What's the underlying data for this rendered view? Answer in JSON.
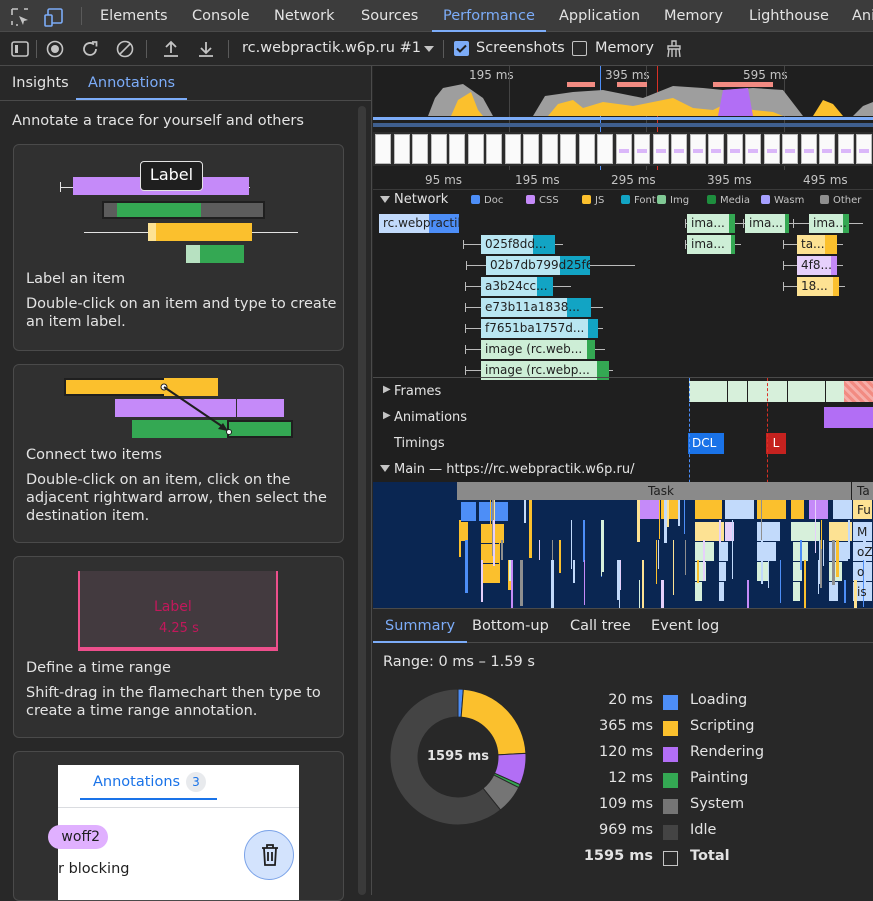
{
  "devtools_tabs": [
    "Elements",
    "Console",
    "Network",
    "Sources",
    "Performance",
    "Application",
    "Memory",
    "Lighthouse",
    "Ani"
  ],
  "active_tab": "Performance",
  "toolbar": {
    "recording_target": "rc.webpractik.w6p.ru #1",
    "screenshots_label": "Screenshots",
    "screenshots_checked": true,
    "memory_label": "Memory",
    "memory_checked": false
  },
  "sidebar": {
    "tabs": [
      "Insights",
      "Annotations"
    ],
    "active": "Annotations",
    "intro": "Annotate a trace for yourself and others",
    "cards": [
      {
        "title": "Label an item",
        "desc": "Double-click on an item and type to create an item label.",
        "demo_label": "Label"
      },
      {
        "title": "Connect two items",
        "desc": "Double-click on an item, click on the adjacent rightward arrow, then select the destination item."
      },
      {
        "title": "Define a time range",
        "desc": "Shift-drag in the flamechart then type to create a time range annotation.",
        "demo_label": "Label",
        "demo_value": "4.25 s"
      },
      {
        "title": "",
        "preview_tab": "Annotations",
        "preview_count": "3",
        "preview_chip": "woff2",
        "preview_text": "r blocking"
      }
    ]
  },
  "overview": {
    "ticks_top": [
      "195 ms",
      "395 ms",
      "595 ms"
    ],
    "ticks_main": [
      "95 ms",
      "195 ms",
      "295 ms",
      "395 ms",
      "495 ms"
    ]
  },
  "network": {
    "title": "Network",
    "legend": [
      {
        "label": "Doc",
        "color": "#4d8ef7"
      },
      {
        "label": "CSS",
        "color": "#c58af9"
      },
      {
        "label": "JS",
        "color": "#fbc02d"
      },
      {
        "label": "Font",
        "color": "#12a4c4"
      },
      {
        "label": "Img",
        "color": "#81c995"
      },
      {
        "label": "Media",
        "color": "#1e8e3e"
      },
      {
        "label": "Wasm",
        "color": "#a6a0ff"
      },
      {
        "label": "Other",
        "color": "#8f8f8f"
      }
    ],
    "requests": [
      "rc.webpractik...",
      "025f8dd...",
      "02b7db799d25f6...",
      "a3b24cc...",
      "e73b11a1838...",
      "f7651ba1757d...",
      "image (rc.web...",
      "image (rc.webp...",
      "ima...",
      "ima...",
      "ima...",
      "ima...",
      "ima...",
      "ta...",
      "4f8...",
      "18..."
    ]
  },
  "tracks": {
    "frames": "Frames",
    "animations": "Animations",
    "timings": "Timings",
    "dcl": "DCL",
    "l": "L",
    "main": "Main — https://rc.webpractik.w6p.ru/",
    "task": "Task",
    "task2": "Ta",
    "flame_labels": [
      "Fu",
      "M",
      "oZ",
      "o",
      "is"
    ]
  },
  "bottom": {
    "tabs": [
      "Summary",
      "Bottom-up",
      "Call tree",
      "Event log"
    ],
    "active": "Summary",
    "range": "Range: 0 ms – 1.59 s",
    "total_center": "1595 ms",
    "rows": [
      {
        "value": "20 ms",
        "name": "Loading",
        "color": "#4d8ef7",
        "ms": 20
      },
      {
        "value": "365 ms",
        "name": "Scripting",
        "color": "#fbc02d",
        "ms": 365
      },
      {
        "value": "120 ms",
        "name": "Rendering",
        "color": "#b26ef5",
        "ms": 120
      },
      {
        "value": "12 ms",
        "name": "Painting",
        "color": "#34a853",
        "ms": 12
      },
      {
        "value": "109 ms",
        "name": "System",
        "color": "#757575",
        "ms": 109
      },
      {
        "value": "969 ms",
        "name": "Idle",
        "color": "#444444",
        "ms": 969
      }
    ],
    "total": {
      "value": "1595 ms",
      "name": "Total"
    }
  }
}
